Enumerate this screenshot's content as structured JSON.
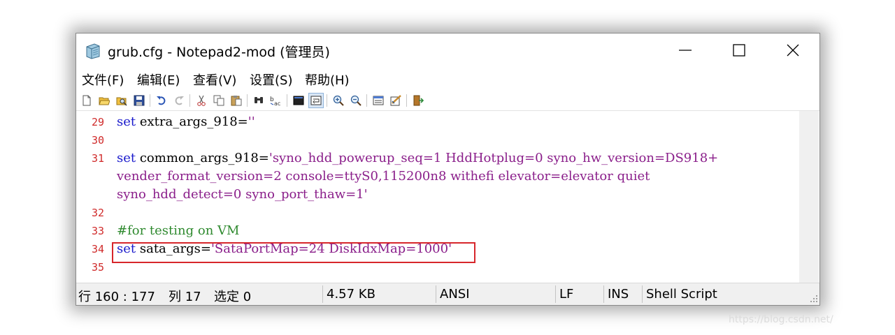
{
  "window": {
    "title": "grub.cfg - Notepad2-mod (管理员)"
  },
  "menu": [
    "文件(F)",
    "编辑(E)",
    "查看(V)",
    "设置(S)",
    "帮助(H)"
  ],
  "toolbar_icons": [
    "new-file-icon",
    "open-folder-icon",
    "browse-icon",
    "save-icon",
    "undo-icon",
    "redo-icon",
    "cut-icon",
    "copy-icon",
    "paste-icon",
    "find-icon",
    "replace-icon",
    "word-wrap-icon",
    "toggle-view-icon",
    "zoom-in-icon",
    "zoom-out-icon",
    "select-scheme-icon",
    "customize-scheme-icon",
    "exit-icon"
  ],
  "editor": {
    "lines": [
      {
        "num": "29",
        "segments": [
          {
            "t": "kw",
            "v": "set"
          },
          {
            "t": "plain",
            "v": " extra_args_918="
          },
          {
            "t": "str",
            "v": "''"
          }
        ]
      },
      {
        "num": "30",
        "segments": []
      },
      {
        "num": "31",
        "segments": [
          {
            "t": "kw",
            "v": "set"
          },
          {
            "t": "plain",
            "v": " common_args_918="
          },
          {
            "t": "str",
            "v": "'syno_hdd_powerup_seq=1 HddHotplug=0 syno_hw_version=DS918+"
          }
        ]
      },
      {
        "num": "",
        "segments": [
          {
            "t": "str",
            "v": "vender_format_version=2 console=ttyS0,115200n8 withefi elevator=elevator quiet"
          }
        ]
      },
      {
        "num": "",
        "segments": [
          {
            "t": "str",
            "v": "syno_hdd_detect=0 syno_port_thaw=1'"
          }
        ]
      },
      {
        "num": "32",
        "segments": []
      },
      {
        "num": "33",
        "segments": [
          {
            "t": "cmt",
            "v": "#for testing on VM"
          }
        ]
      },
      {
        "num": "34",
        "segments": [
          {
            "t": "kw",
            "v": "set"
          },
          {
            "t": "plain",
            "v": " sata_args="
          },
          {
            "t": "str",
            "v": "'SataPortMap=24 DiskIdxMap=1000'"
          }
        ]
      },
      {
        "num": "35",
        "segments": []
      }
    ]
  },
  "status": {
    "position": "行 160 : 177",
    "column": "列 17",
    "selection": "选定 0",
    "size": "4.57 KB",
    "encoding": "ANSI",
    "line_ending": "LF",
    "insert_mode": "INS",
    "scheme": "Shell Script"
  },
  "watermark": "https://blog.csdn.net/",
  "colors": {
    "keyword": "#1a1acc",
    "string": "#8a1e8a",
    "comment": "#2f8a2f",
    "line_number": "#d02b2b",
    "highlight_box": "#d7262b"
  }
}
